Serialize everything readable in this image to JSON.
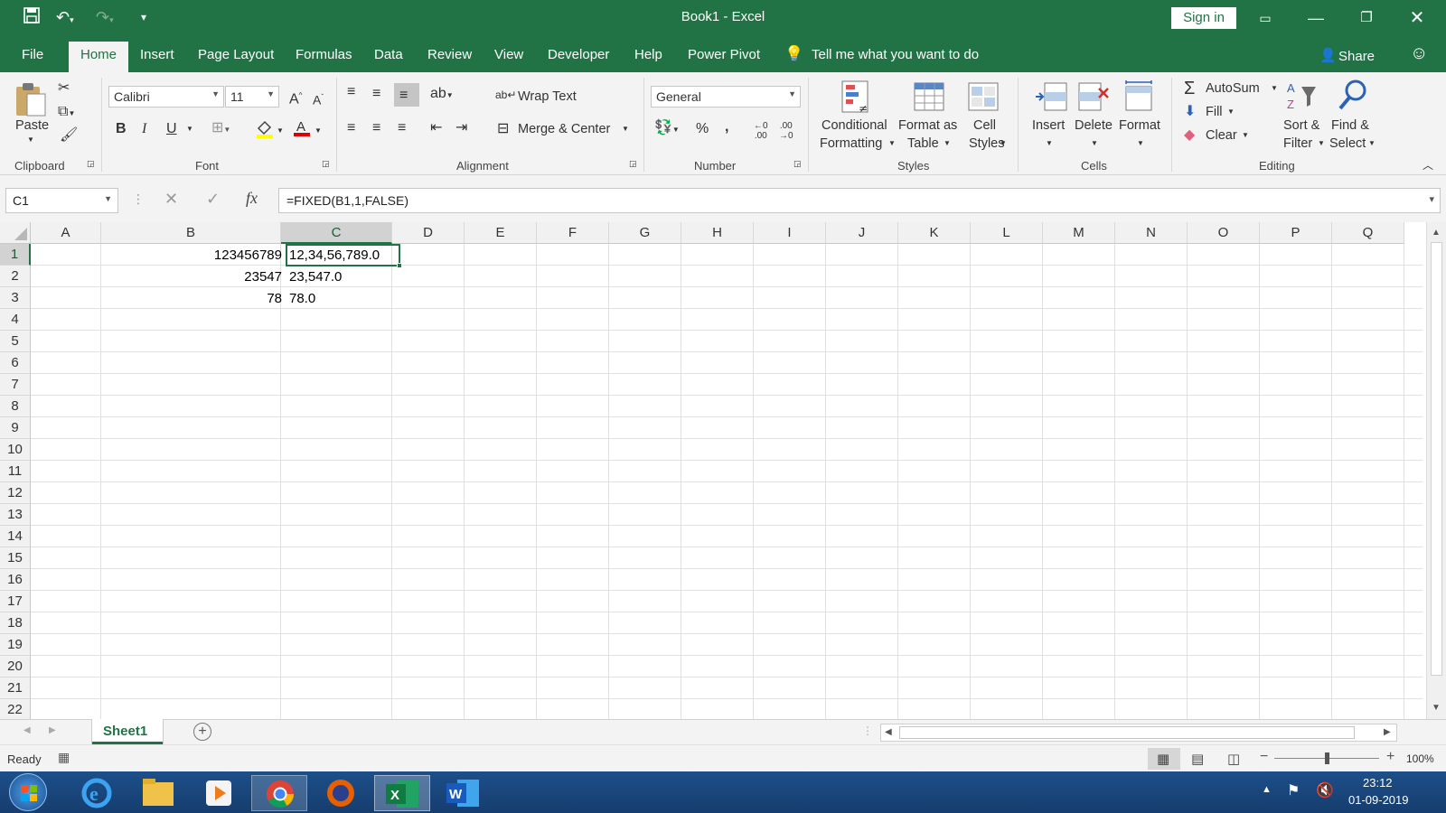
{
  "title_bar": {
    "title": "Book1  -  Excel",
    "sign_in": "Sign in"
  },
  "tabs": [
    {
      "label": "File"
    },
    {
      "label": "Home"
    },
    {
      "label": "Insert"
    },
    {
      "label": "Page Layout"
    },
    {
      "label": "Formulas"
    },
    {
      "label": "Data"
    },
    {
      "label": "Review"
    },
    {
      "label": "View"
    },
    {
      "label": "Developer"
    },
    {
      "label": "Help"
    },
    {
      "label": "Power Pivot"
    }
  ],
  "tell_me": "Tell me what you want to do",
  "share": "Share",
  "ribbon": {
    "clipboard": {
      "label": "Clipboard",
      "paste": "Paste"
    },
    "font": {
      "label": "Font",
      "name": "Calibri",
      "size": "11",
      "bold": "B",
      "italic": "I",
      "underline": "U"
    },
    "alignment": {
      "label": "Alignment",
      "wrap_text": "Wrap Text",
      "merge_center": "Merge & Center"
    },
    "number": {
      "label": "Number",
      "format": "General"
    },
    "styles": {
      "label": "Styles",
      "conditional_1": "Conditional",
      "conditional_2": "Formatting",
      "format_as_1": "Format as",
      "format_as_2": "Table",
      "cell_styles_1": "Cell",
      "cell_styles_2": "Styles"
    },
    "cells": {
      "label": "Cells",
      "insert": "Insert",
      "delete": "Delete",
      "format": "Format"
    },
    "editing": {
      "label": "Editing",
      "autosum": "AutoSum",
      "fill": "Fill",
      "clear": "Clear",
      "sort_1": "Sort &",
      "sort_2": "Filter",
      "find_1": "Find &",
      "find_2": "Select"
    }
  },
  "formula_bar": {
    "name_box": "C1",
    "formula": "=FIXED(B1,1,FALSE)"
  },
  "columns": [
    "A",
    "B",
    "C",
    "D",
    "E",
    "F",
    "G",
    "H",
    "I",
    "J",
    "K",
    "L",
    "M",
    "N",
    "O",
    "P",
    "Q"
  ],
  "rows": [
    "1",
    "2",
    "3",
    "4",
    "5",
    "6",
    "7",
    "8",
    "9",
    "10",
    "11",
    "12",
    "13",
    "14",
    "15",
    "16",
    "17",
    "18",
    "19",
    "20",
    "21",
    "22"
  ],
  "cells": {
    "B1": "123456789",
    "B2": "23547",
    "B3": "78",
    "C1": "12,34,56,789.0",
    "C2": "23,547.0",
    "C3": "78.0"
  },
  "sheet_tab": "Sheet1",
  "status": {
    "ready": "Ready",
    "zoom": "100%"
  },
  "clock": {
    "time": "23:12",
    "date": "01-09-2019"
  },
  "colors": {
    "excel_green": "#217346",
    "selection_border": "#217346"
  }
}
